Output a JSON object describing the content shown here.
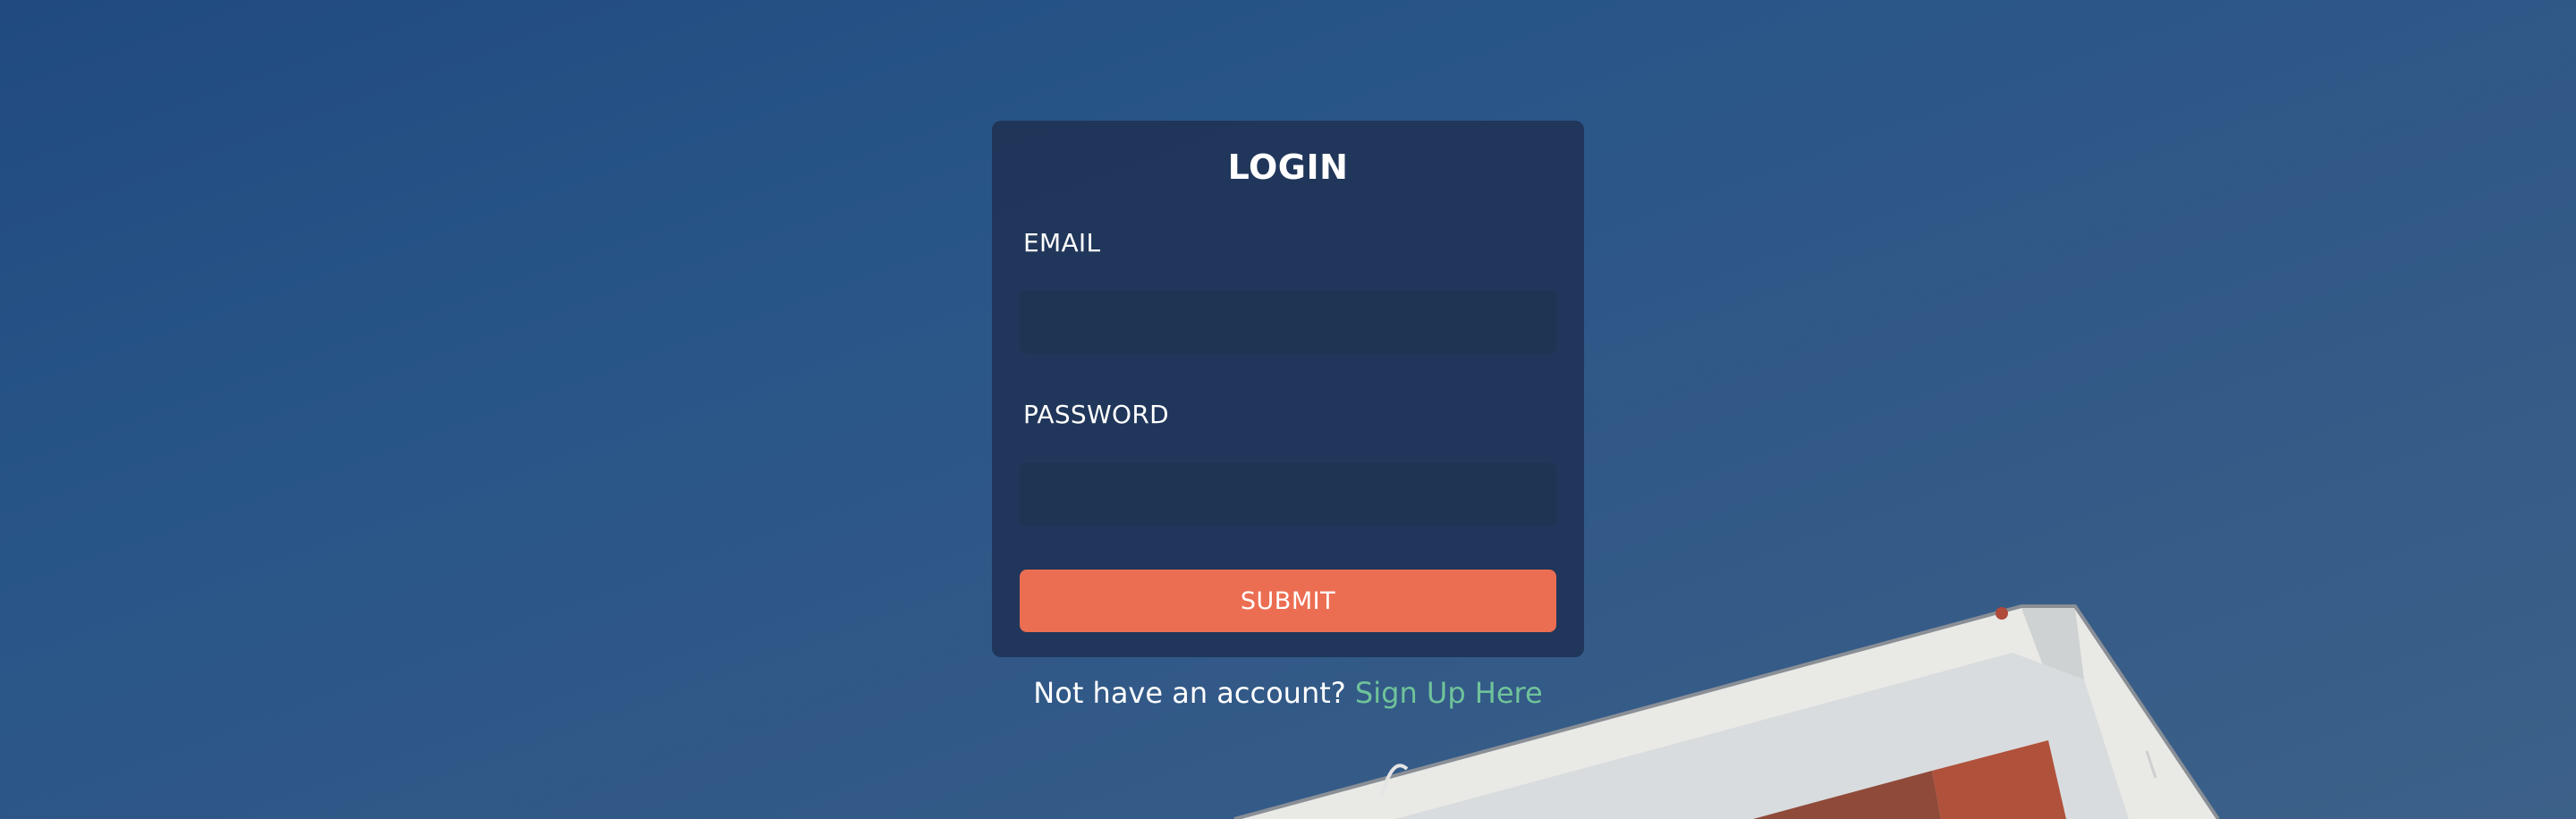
{
  "login": {
    "title": "LOGIN",
    "email_label": "EMAIL",
    "email_value": "",
    "password_label": "PASSWORD",
    "password_value": "",
    "submit_label": "SUBMIT"
  },
  "footer": {
    "prompt": "Not have an account?",
    "link_label": "Sign Up Here"
  },
  "colors": {
    "submit": "#ec6e52",
    "link": "#6fc39a",
    "card": "#1f3456"
  }
}
